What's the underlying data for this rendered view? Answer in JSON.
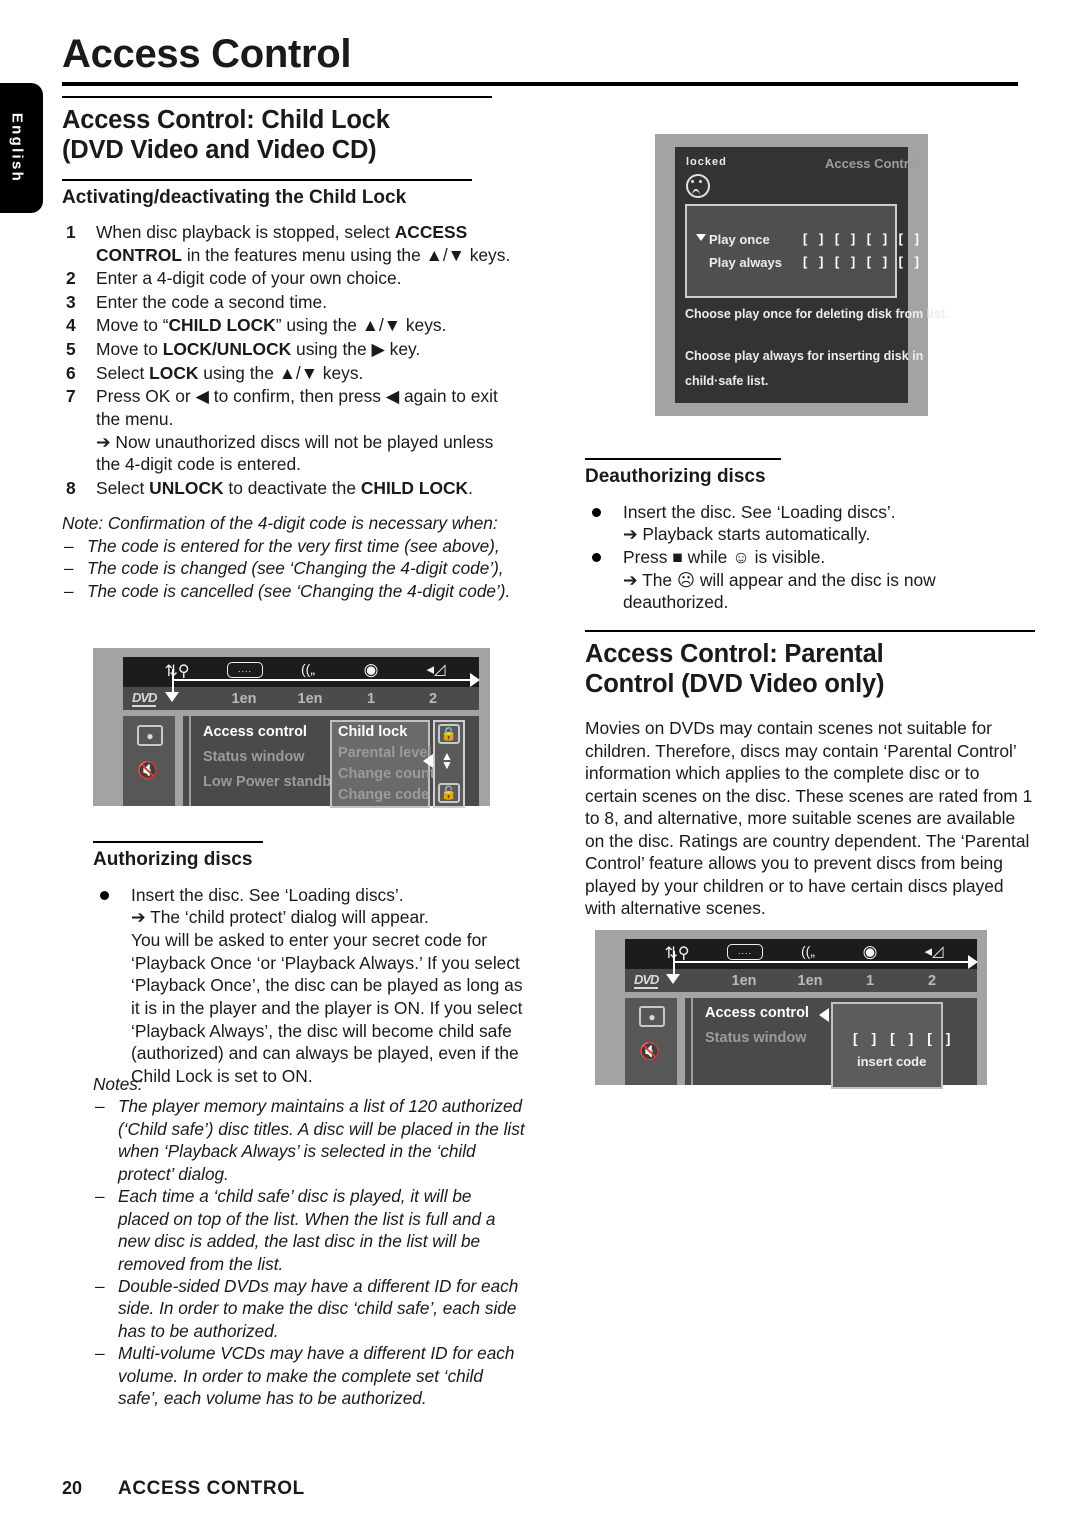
{
  "page": {
    "language_tab": "English",
    "masthead_title": "Access Control",
    "footer_page_number": "20",
    "footer_title": "ACCESS CONTROL"
  },
  "left_column": {
    "section_heading_line1": "Access Control: Child Lock",
    "section_heading_line2": "(DVD Video and Video CD)",
    "subheading": "Activating/deactivating the Child Lock",
    "steps": [
      {
        "num": "1",
        "text_a": "When disc playback is stopped, select ",
        "bold_a": "ACCESS CONTROL",
        "text_b": " in the features menu using the ▲/▼ keys."
      },
      {
        "num": "2",
        "text_a": "Enter a 4-digit code of your own choice.",
        "bold_a": "",
        "text_b": ""
      },
      {
        "num": "3",
        "text_a": "Enter the code a second time.",
        "bold_a": "",
        "text_b": ""
      },
      {
        "num": "4",
        "text_a": "Move to “",
        "bold_a": "CHILD LOCK",
        "text_b": "” using the ▲/▼ keys."
      },
      {
        "num": "5",
        "text_a": "Move to ",
        "bold_a": "LOCK/UNLOCK",
        "text_b": " using the ▶ key."
      },
      {
        "num": "6",
        "text_a": "Select ",
        "bold_a": "LOCK",
        "text_b": " using the ▲/▼ keys."
      },
      {
        "num": "7",
        "text_a": "Press OK or ◀ to confirm, then press ◀ again to exit the menu.",
        "bold_a": "",
        "text_b": ""
      },
      {
        "num": "8",
        "text_a": "Select ",
        "bold_a": "UNLOCK",
        "text_b": " to deactivate the ",
        "bold_b": "CHILD LOCK",
        "text_c": "."
      }
    ],
    "step7_arrow": "➔ Now unauthorized discs will not be played unless the 4-digit code is entered.",
    "note_lead": "Note: Confirmation of the 4-digit code is necessary when:",
    "note_items": [
      "The code is entered for the very first time (see above),",
      "The code is changed (see ‘Changing the 4-digit code’),",
      "The code is cancelled (see ‘Changing the 4-digit code’)."
    ],
    "authorizing_heading": "Authorizing discs",
    "authorizing_bullet_line1": "Insert the disc. See ‘Loading discs’.",
    "authorizing_bullet_line2": "➔ The ‘child protect’ dialog will appear.",
    "authorizing_body": "You will be asked to enter your secret code for ‘Playback Once ‘or ‘Playback Always.’ If you select ‘Playback Once’, the disc can be played as long as it is in the player and the player is ON. If you select ‘Playback Always’, the disc will become child safe (authorized) and can always be played, even if the Child Lock is set to ON.",
    "notes_lead": "Notes:",
    "notes_items": [
      "The player memory maintains a list of 120 authorized (‘Child safe’) disc titles. A disc will be placed in the list when ‘Playback Always’ is selected in the ‘child protect’ dialog.",
      "Each time a ‘child safe’ disc is played, it will be placed on top of the list. When the list is full and a new disc is added, the last disc in the list will be removed from the list.",
      "Double-sided DVDs may have a different ID for each side. In order to make the disc ‘child safe’, each side has to be authorized.",
      "Multi-volume VCDs may have a different ID for each volume. In order to make the complete set ‘child safe’, each volume has to be authorized."
    ]
  },
  "right_column": {
    "deauthorizing_heading": "Deauthorizing discs",
    "deauth_bullets": [
      {
        "line1": "Insert the disc. See ‘Loading discs’.",
        "line2": "➔ Playback starts automatically."
      },
      {
        "line1": "Press ■ while ☺ is visible.",
        "line2": "➔ The ☹ will appear and the disc is now deauthorized."
      }
    ],
    "parental_heading_line1": "Access Control: Parental",
    "parental_heading_line2": "Control (DVD Video only)",
    "parental_body": "Movies on DVDs may contain scenes not suitable for children. Therefore, discs may contain ‘Parental Control’ information which applies to the complete disc or to certain scenes on the disc. These scenes are rated from 1 to 8, and alternative, more suitable scenes are available on the disc. Ratings are country dependent. The ‘Parental Control’ feature allows you to prevent discs from being played by your children or to have certain discs played with alternative scenes."
  },
  "locked_screenshot": {
    "status_label": "locked",
    "title": "Access Control",
    "option_once": "Play once",
    "option_always": "Play always",
    "code_slots": "[ ]  [ ]  [ ]  [ ]",
    "hint_line1": "Choose play once for deleting  disk from list.",
    "hint_line2": "Choose play always for inserting disk in",
    "hint_line3": "child·safe list.",
    "colors": {
      "frame": "#a3a3a3",
      "panel": "#333333",
      "box": "#4f4f4f"
    }
  },
  "osd_screenshot_left": {
    "disc_logo": "DVD",
    "tab_labels": [
      "1en",
      "1en",
      "1",
      "2"
    ],
    "menu_items": [
      "Access control",
      "Status window",
      "Low Power standby"
    ],
    "submenu_items": [
      "Child lock",
      "Parental level",
      "Change country",
      "Change code"
    ],
    "selected_menu_item": "Access control",
    "selected_submenu_item": "Child lock",
    "icons": [
      "tools-icon",
      "subtitle-icon",
      "audio-icon",
      "disc-icon",
      "volume-icon",
      "eject-icon",
      "mute-icon",
      "lock-closed-icon",
      "lock-open-icon",
      "updown-arrow-icon"
    ]
  },
  "osd_screenshot_right": {
    "disc_logo": "DVD",
    "tab_labels": [
      "1en",
      "1en",
      "1",
      "2"
    ],
    "menu_items": [
      "Access control",
      "Status window"
    ],
    "selected_menu_item": "Access control",
    "code_slots": "[ ]  [ ]  [ ]",
    "code_caption": "insert code",
    "icons": [
      "tools-icon",
      "subtitle-icon",
      "audio-icon",
      "disc-icon",
      "volume-icon",
      "eject-icon",
      "mute-icon"
    ]
  }
}
